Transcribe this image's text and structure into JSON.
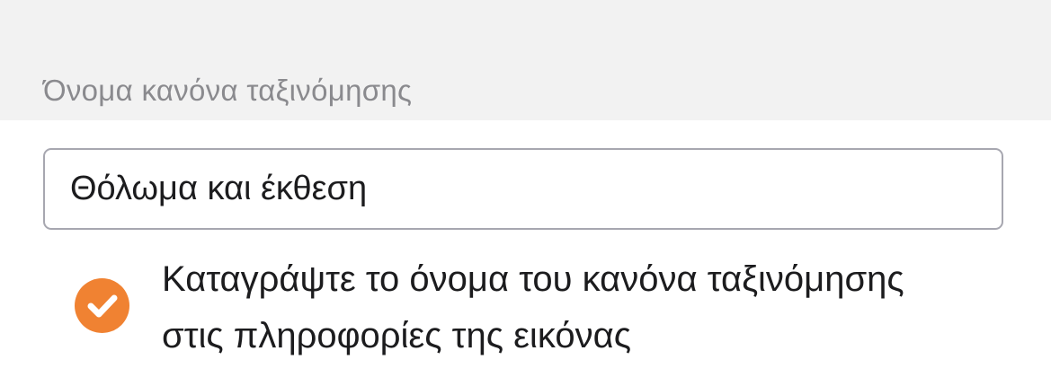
{
  "section": {
    "label": "Όνομα κανόνα ταξινόμησης"
  },
  "rule_name_field": {
    "value": "Θόλωμα και έκθεση"
  },
  "record_option": {
    "checked": true,
    "label_line_1": "Καταγράψτε το όνομα του κανόνα ταξινόμησης",
    "label_line_2": "στις πληροφορίες της εικόνας",
    "accent_color": "#f08232",
    "icon": "checkmark-icon"
  }
}
